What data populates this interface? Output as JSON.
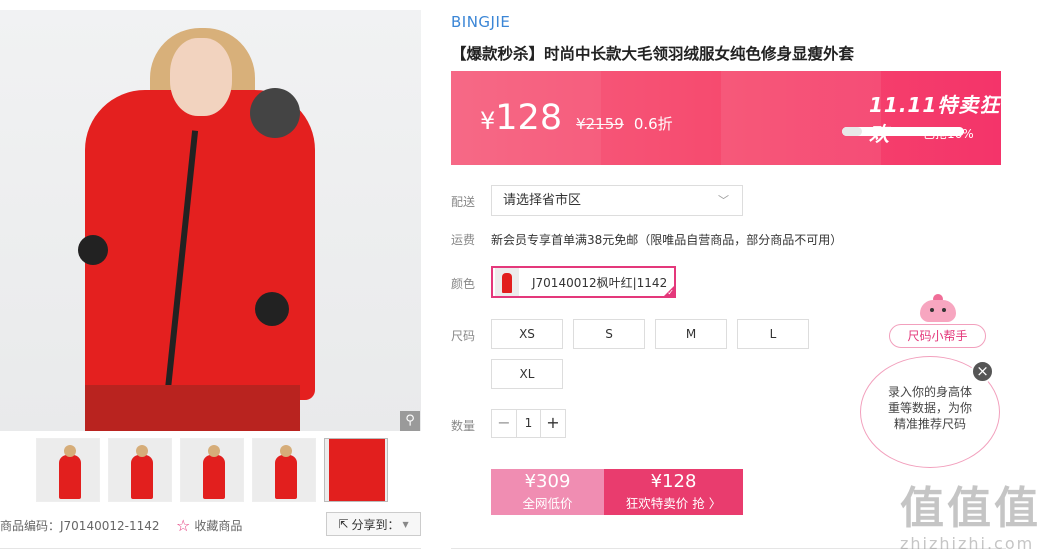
{
  "gallery": {
    "product_code": "商品编码：J70140012-1142",
    "favorite_label": "收藏商品",
    "share_label": "分享到："
  },
  "product": {
    "brand": "BINGJIE",
    "title": "【爆款秒杀】时尚中长款大毛领羽绒服女纯色修身显瘦外套"
  },
  "price": {
    "currency": "¥",
    "current": "128",
    "original": "¥2159",
    "discount": "0.6折",
    "event_title": "11.11特卖狂欢",
    "sold_label": "已抢16%",
    "sold_fraction": 0.16
  },
  "delivery": {
    "label": "配送",
    "region_placeholder": "请选择省市区"
  },
  "shipping": {
    "label": "运费",
    "text": "新会员专享首单满38元免邮（限唯品自营商品，部分商品不可用）"
  },
  "color": {
    "label": "颜色",
    "selected": "J70140012枫叶红|1142"
  },
  "size": {
    "label": "尺码",
    "options": [
      "XS",
      "S",
      "M",
      "L",
      "XL"
    ]
  },
  "quantity": {
    "label": "数量",
    "value": "1",
    "minus": "−",
    "plus": "+"
  },
  "buy": {
    "low_price": "¥309",
    "low_label": "全网低价",
    "now_price": "¥128",
    "now_label": "狂欢特卖价 抢 〉"
  },
  "helper": {
    "pill": "尺码小帮手",
    "bubble_line1": "录入你的身高体",
    "bubble_line2": "重等数据，为你",
    "bubble_line3": "精准推荐尺码",
    "close": "×"
  },
  "watermark": {
    "main": "值值值",
    "url": "zhizhizhi.com"
  },
  "colors": {
    "accent_pink": "#e4387b",
    "buy_now": "#e93c6e",
    "buy_low": "#f08db2",
    "brand_blue": "#3b86d6"
  }
}
